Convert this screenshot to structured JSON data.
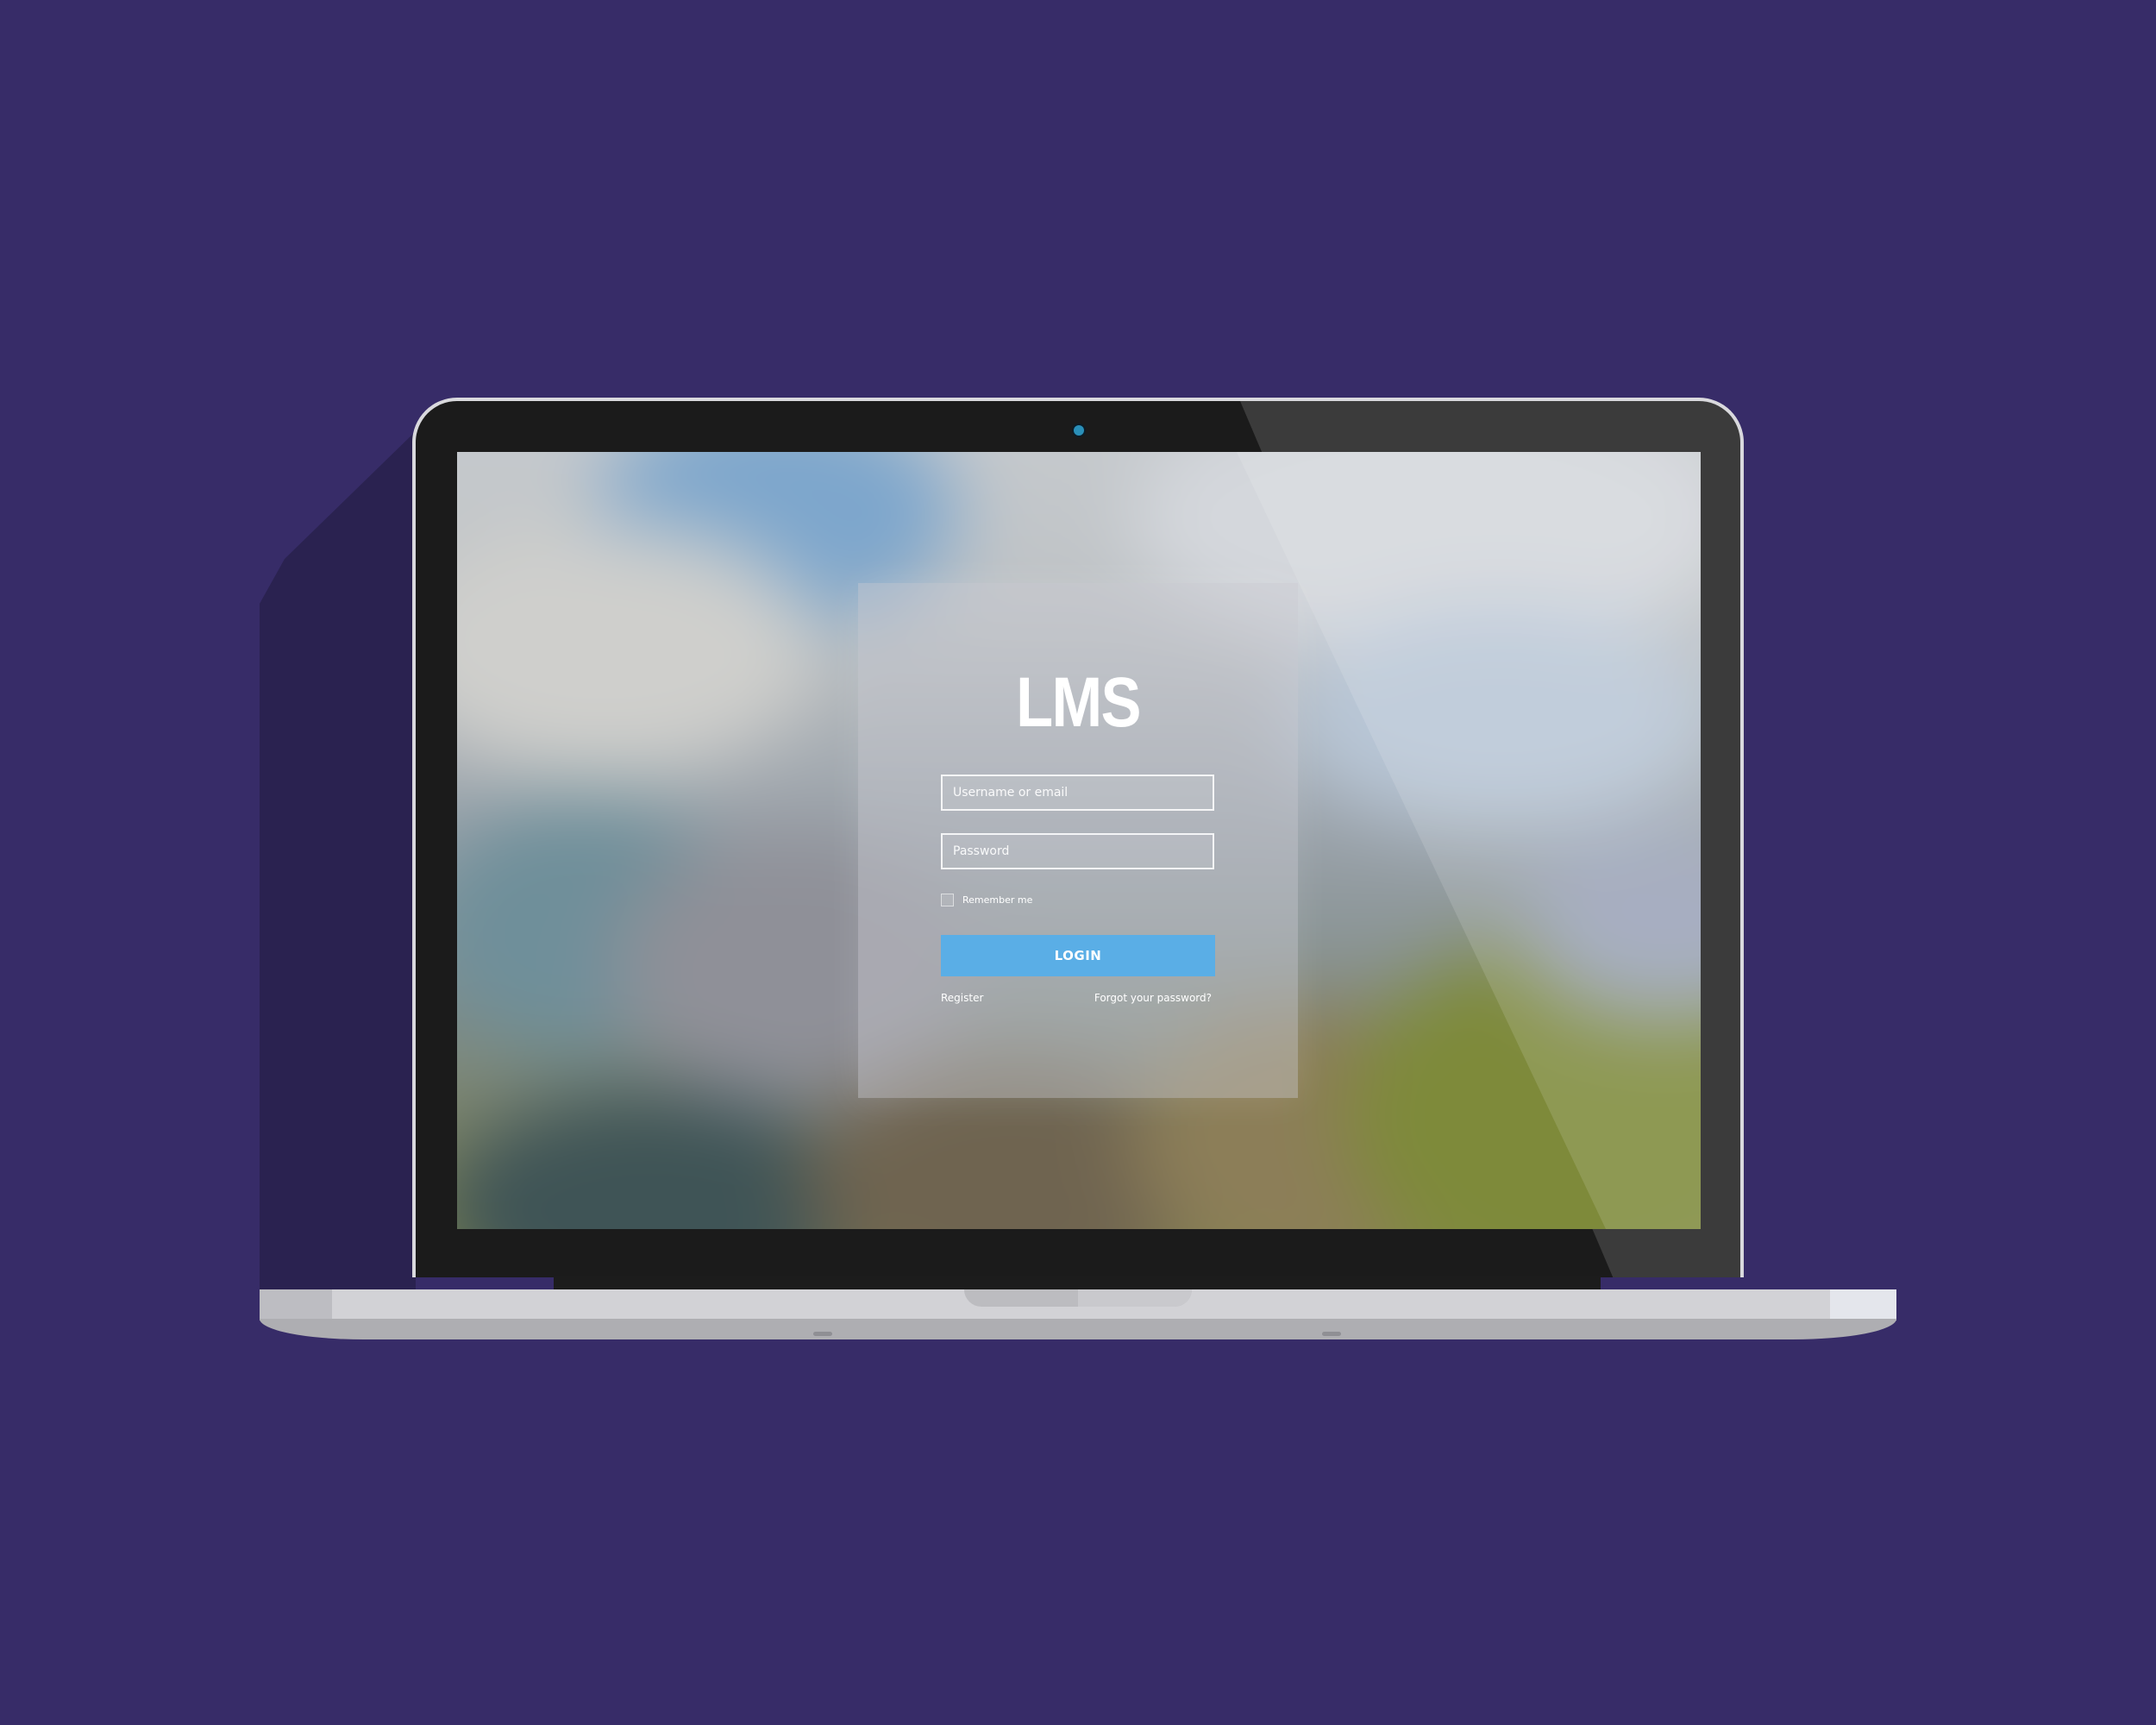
{
  "app": {
    "logo_text": "LMS"
  },
  "login_form": {
    "username_placeholder": "Username or email",
    "password_placeholder": "Password",
    "remember_label": "Remember me",
    "remember_checked": false,
    "login_label": "LOGIN",
    "register_label": "Register",
    "forgot_label": "Forgot your password?"
  },
  "colors": {
    "background": "#372c68",
    "accent_button": "#5aaee6",
    "bezel": "#1b1b1b",
    "camera": "#2a8fb8"
  },
  "icons": {
    "camera": "camera-dot-icon",
    "checkbox": "checkbox-icon"
  }
}
